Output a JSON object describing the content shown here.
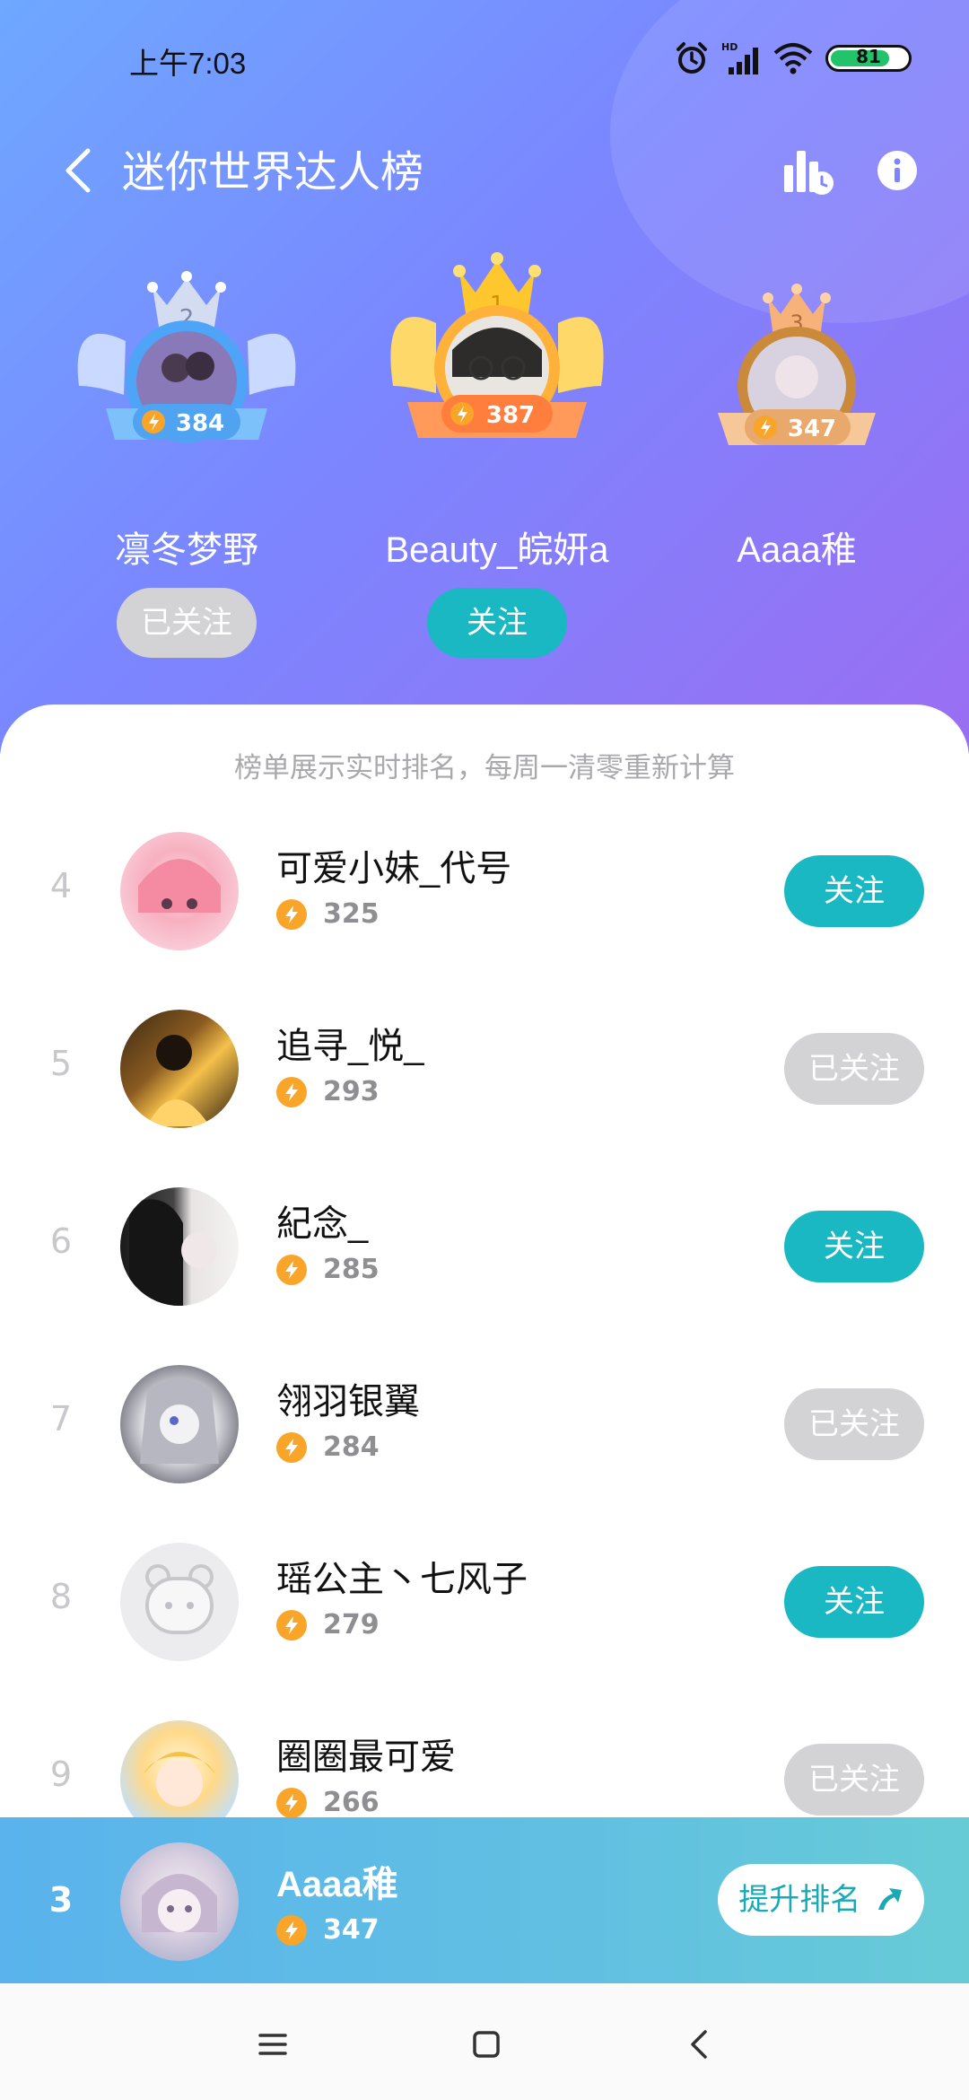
{
  "status": {
    "time": "上午7:03",
    "battery": "81",
    "network": "HD"
  },
  "header": {
    "title": "迷你世界达人榜",
    "back_icon": "back-arrow-icon",
    "history_icon": "rank-history-icon",
    "info_icon": "info-icon"
  },
  "podium": [
    {
      "rank": "2",
      "name": "凛冬梦野",
      "score": "384",
      "button": "已关注",
      "followed": true
    },
    {
      "rank": "1",
      "name": "Beauty_皖妍a",
      "score": "387",
      "button": "关注",
      "followed": false
    },
    {
      "rank": "3",
      "name": "Aaaa稚",
      "score": "347"
    }
  ],
  "notice": "榜单展示实时排名，每周一清零重新计算",
  "list": [
    {
      "rank": "4",
      "name": "可爱小妹_代号",
      "score": "325",
      "button": "关注",
      "followed": false
    },
    {
      "rank": "5",
      "name": "追寻_悦_",
      "score": "293",
      "button": "已关注",
      "followed": true
    },
    {
      "rank": "6",
      "name": "紀念_",
      "score": "285",
      "button": "关注",
      "followed": false
    },
    {
      "rank": "7",
      "name": "翎羽银翼",
      "score": "284",
      "button": "已关注",
      "followed": true
    },
    {
      "rank": "8",
      "name": "瑶公主丶七风子",
      "score": "279",
      "button": "关注",
      "followed": false
    },
    {
      "rank": "9",
      "name": "圈圈最可爱",
      "score": "266",
      "button": "已关注",
      "followed": true
    }
  ],
  "me": {
    "rank": "3",
    "name": "Aaaa稚",
    "score": "347",
    "button": "提升排名"
  },
  "colors": {
    "accent": "#19b8c2",
    "followed": "#d3d3d6",
    "bolt": "#f8a52a"
  }
}
